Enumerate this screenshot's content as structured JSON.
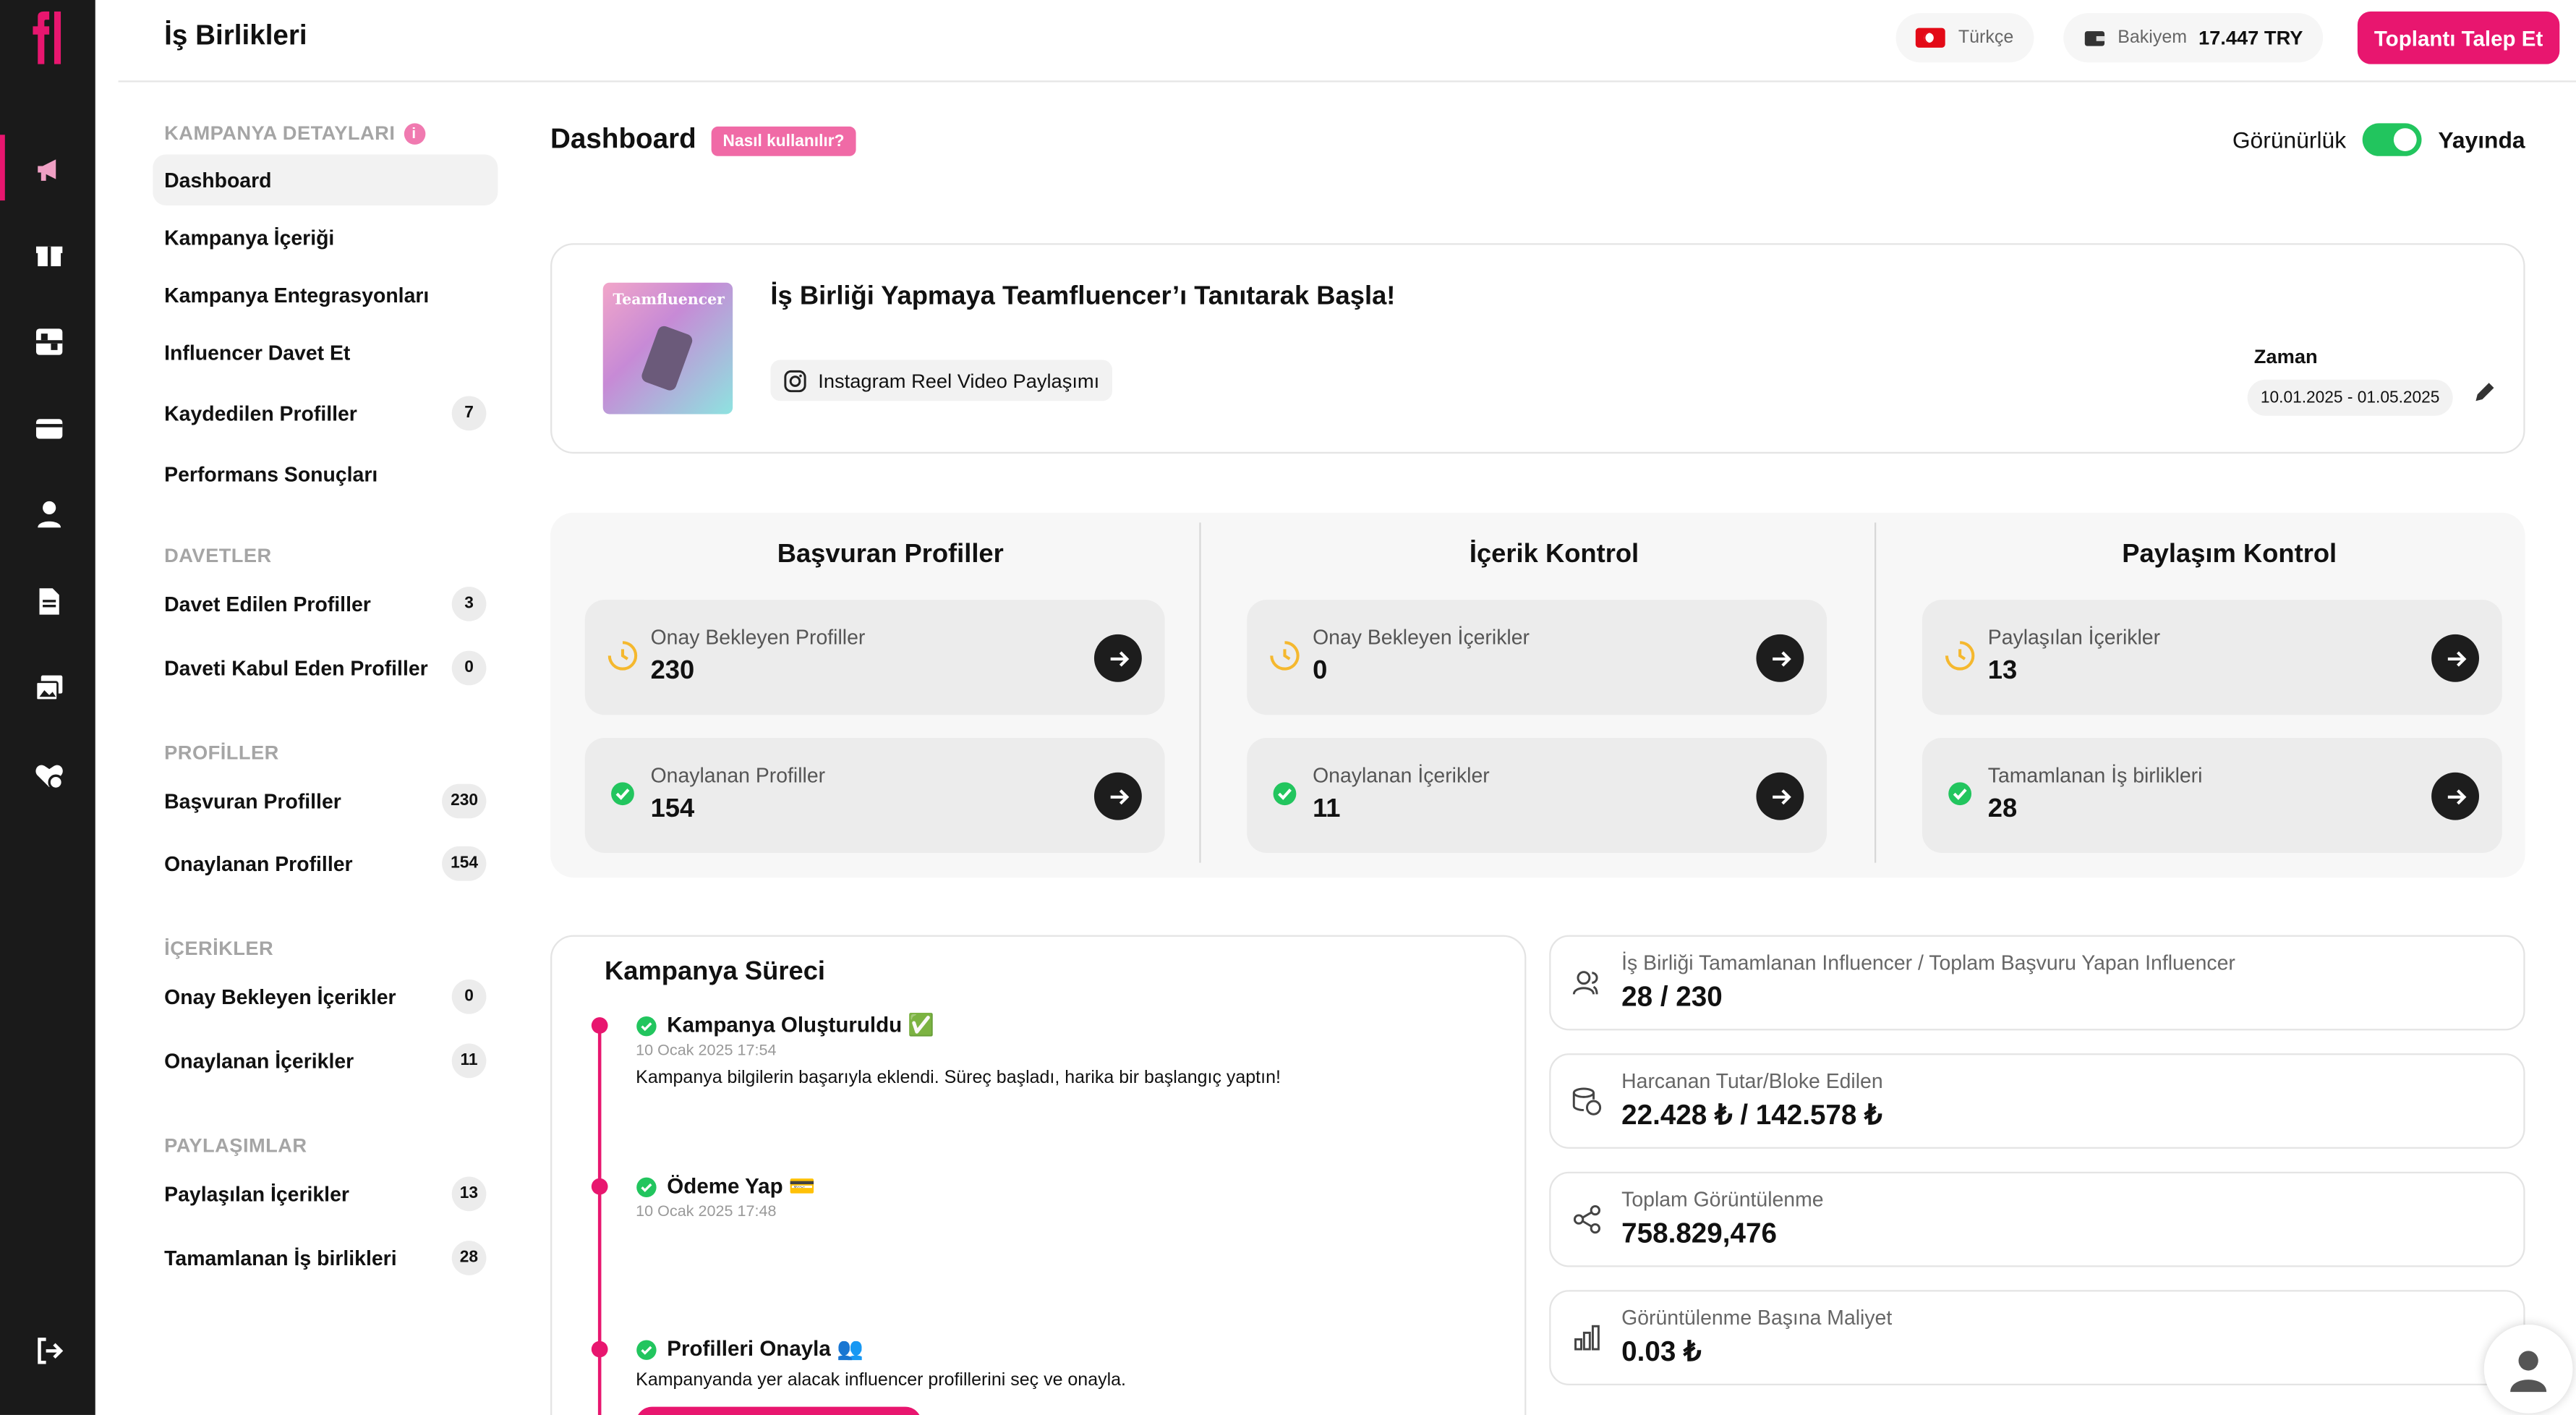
{
  "header": {
    "title": "İş Birlikleri",
    "language": "Türkçe",
    "balance_label": "Bakiyem",
    "balance_value": "17.447 TRY",
    "cta": "Toplantı Talep Et"
  },
  "rail": {
    "logo": "tf-logo",
    "icons": [
      "megaphone-icon",
      "gift-icon",
      "qr-scan-icon",
      "card-icon",
      "user-icon",
      "document-icon",
      "gallery-icon",
      "heart-settings-icon",
      "logout-icon"
    ]
  },
  "sidebar": {
    "campaign_section": "KAMPANYA DETAYLARI",
    "campaign_items": [
      {
        "label": "Dashboard",
        "count": ""
      },
      {
        "label": "Kampanya İçeriği",
        "count": ""
      },
      {
        "label": "Kampanya Entegrasyonları",
        "count": ""
      },
      {
        "label": "Influencer Davet Et",
        "count": ""
      },
      {
        "label": "Kaydedilen Profiller",
        "count": "7"
      },
      {
        "label": "Performans Sonuçları",
        "count": ""
      }
    ],
    "invites_section": "DAVETLER",
    "invites_items": [
      {
        "label": "Davet Edilen Profiller",
        "count": "3"
      },
      {
        "label": "Daveti Kabul Eden Profiller",
        "count": "0"
      }
    ],
    "profiles_section": "PROFİLLER",
    "profiles_items": [
      {
        "label": "Başvuran Profiller",
        "count": "230"
      },
      {
        "label": "Onaylanan Profiller",
        "count": "154"
      }
    ],
    "contents_section": "İÇERİKLER",
    "contents_items": [
      {
        "label": "Onay Bekleyen İçerikler",
        "count": "0"
      },
      {
        "label": "Onaylanan İçerikler",
        "count": "11"
      }
    ],
    "shares_section": "PAYLAŞIMLAR",
    "shares_items": [
      {
        "label": "Paylaşılan İçerikler",
        "count": "13"
      },
      {
        "label": "Tamamlanan İş birlikleri",
        "count": "28"
      }
    ]
  },
  "main": {
    "title": "Dashboard",
    "howto": "Nasıl kullanılır?",
    "visibility_label": "Görünürlük",
    "visibility_state": "Yayında",
    "campaign": {
      "thumb_text": "Teamfluencer",
      "title": "İş Birliği Yapmaya Teamfluencer’ı Tanıtarak Başla!",
      "type": "Instagram Reel Video Paylaşımı",
      "time_label": "Zaman",
      "dates": "10.01.2025 - 01.05.2025"
    },
    "columns": [
      {
        "title": "Başvuran Profiller",
        "cards": [
          {
            "label": "Onay Bekleyen Profiller",
            "value": "230"
          },
          {
            "label": "Onaylanan Profiller",
            "value": "154"
          }
        ]
      },
      {
        "title": "İçerik Kontrol",
        "cards": [
          {
            "label": "Onay Bekleyen İçerikler",
            "value": "0"
          },
          {
            "label": "Onaylanan İçerikler",
            "value": "11"
          }
        ]
      },
      {
        "title": "Paylaşım Kontrol",
        "cards": [
          {
            "label": "Paylaşılan İçerikler",
            "value": "13"
          },
          {
            "label": "Tamamlanan İş birlikleri",
            "value": "28"
          }
        ]
      }
    ],
    "process": {
      "title": "Kampanya Süreci",
      "steps": [
        {
          "title": "Kampanya Oluşturuldu ✅",
          "date": "10 Ocak 2025 17:54",
          "desc": "Kampanya bilgilerin başarıyla eklendi. Süreç başladı, harika bir başlangıç yaptın!"
        },
        {
          "title": "Ödeme Yap 💳",
          "date": "10 Ocak 2025 17:48",
          "desc": ""
        },
        {
          "title": "Profilleri Onayla 👥",
          "date": "",
          "desc": "Kampanyanda yer alacak influencer profillerini seç ve onayla."
        }
      ]
    },
    "stats": [
      {
        "label": "İş Birliği Tamamlanan Influencer / Toplam Başvuru Yapan Influencer",
        "value": "28 / 230",
        "icon": "users-icon"
      },
      {
        "label": "Harcanan Tutar/Bloke Edilen",
        "value": "22.428 ₺ / 142.578 ₺",
        "icon": "coins-icon"
      },
      {
        "label": "Toplam Görüntülenme",
        "value": "758.829,476",
        "icon": "share-icon"
      },
      {
        "label": "Görüntülenme Başına Maliyet",
        "value": "0.03 ₺",
        "icon": "bar-chart-icon"
      }
    ]
  },
  "colors": {
    "accent": "#e8166f",
    "rail": "#1a1a1a",
    "success": "#22c55e",
    "pending": "#f5b82e"
  }
}
